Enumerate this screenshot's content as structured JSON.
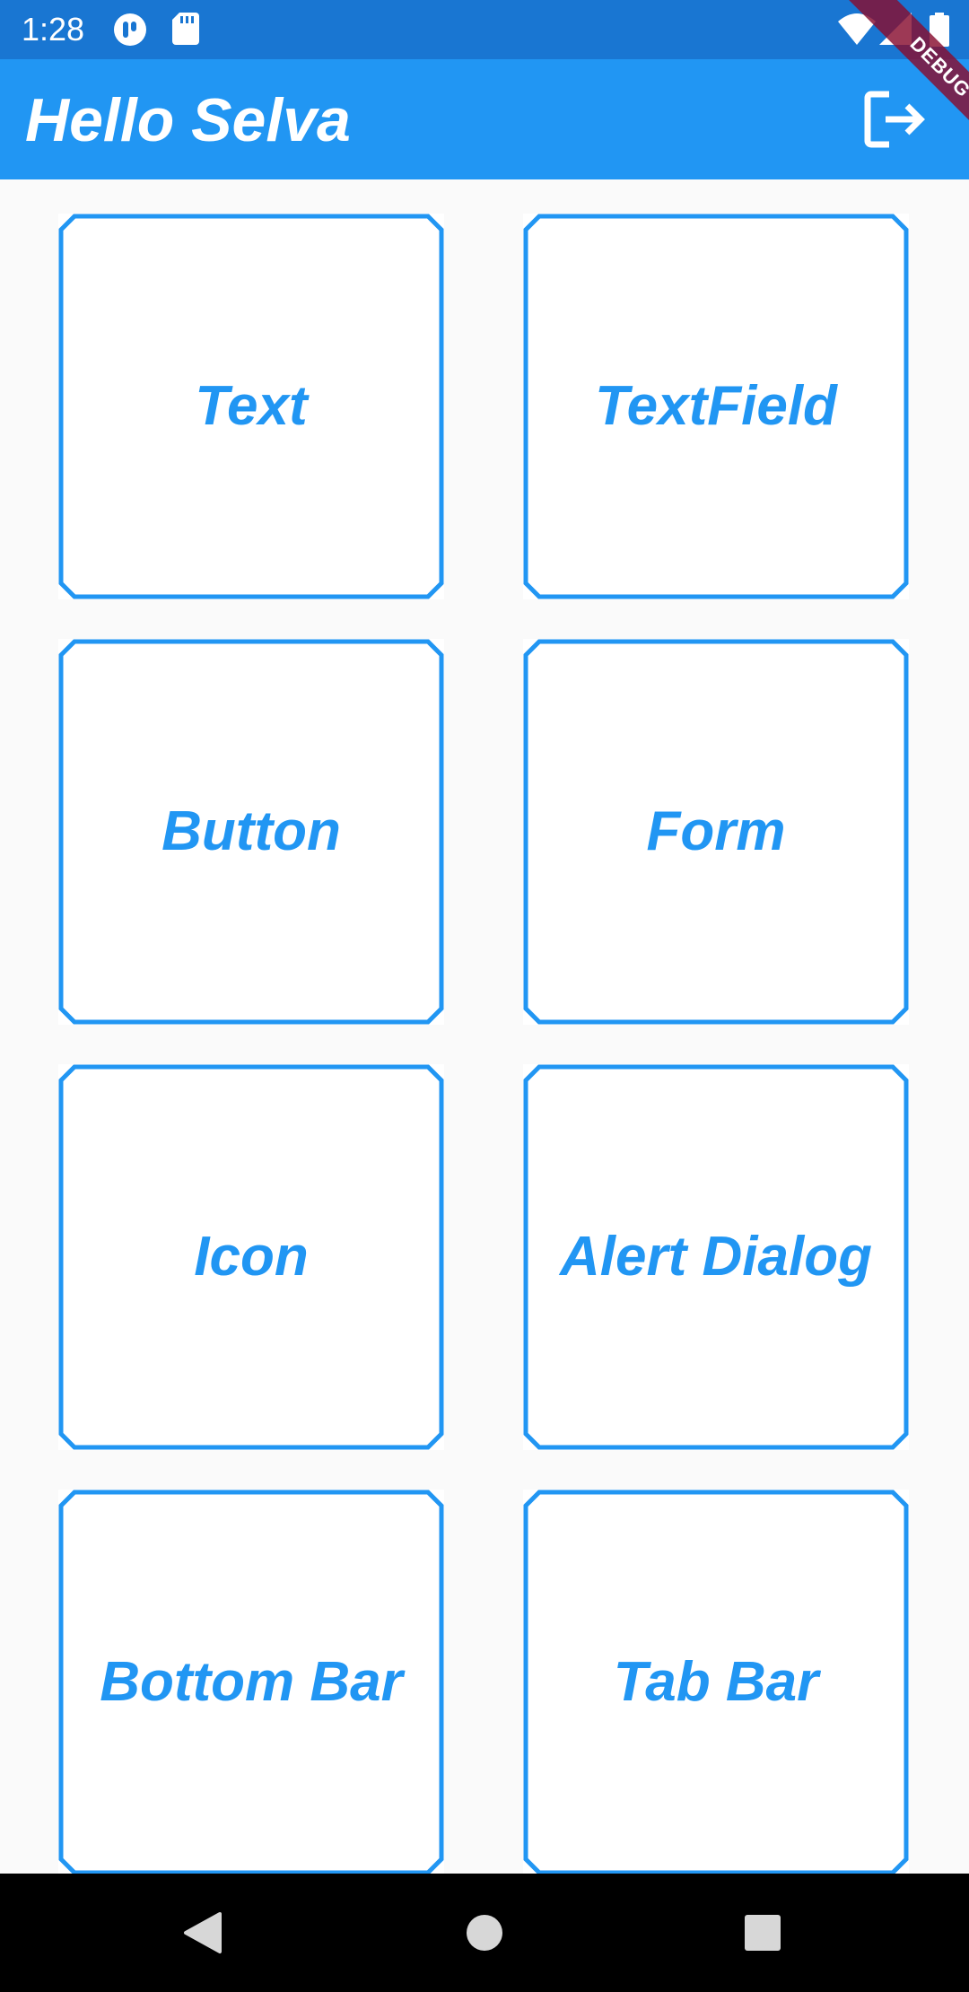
{
  "status_bar": {
    "time": "1:28",
    "left_icons": [
      "app-notification-icon",
      "sd-card-icon"
    ],
    "right_icons": [
      "wifi-icon",
      "cell-signal-icon",
      "battery-icon"
    ]
  },
  "debug_banner": {
    "label": "DEBUG"
  },
  "app_bar": {
    "title": "Hello Selva",
    "action_icon": "logout-icon"
  },
  "tiles": [
    {
      "label": "Text"
    },
    {
      "label": "TextField"
    },
    {
      "label": "Button"
    },
    {
      "label": "Form"
    },
    {
      "label": "Icon"
    },
    {
      "label": "Alert Dialog"
    },
    {
      "label": "Bottom Bar"
    },
    {
      "label": "Tab Bar"
    }
  ],
  "nav_bar": {
    "icons": [
      "back-icon",
      "home-icon",
      "recents-icon"
    ]
  },
  "colors": {
    "status_bar": "#1976d2",
    "app_bar": "#2196f3",
    "accent": "#2196f3",
    "background": "#fafafa",
    "debug_banner": "#880e30"
  }
}
